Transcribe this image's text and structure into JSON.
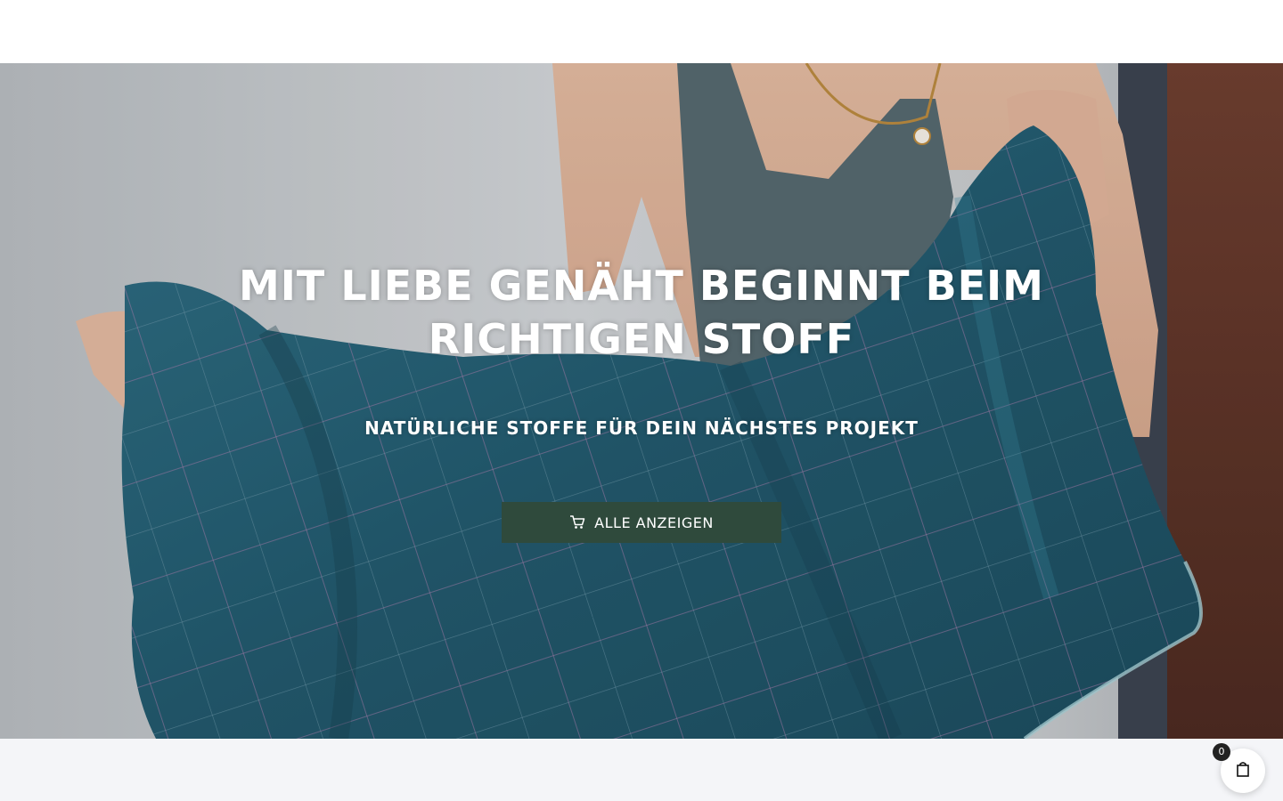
{
  "hero": {
    "title": "MIT LIEBE GENÄHT BEGINNT BEIM RICHTIGEN STOFF",
    "subtitle": "NATÜRLICHE STOFFE FÜR DEIN NÄCHSTES PROJEKT",
    "cta_label": "ALLE ANZEIGEN",
    "cta_icon": "cart-icon",
    "image_subject": "woman holding teal plaid linen fabric"
  },
  "cart": {
    "count": "0",
    "icon": "bag-icon"
  },
  "colors": {
    "cta_background": "#2f4a3c",
    "fabric": "#2a6378",
    "header_background": "#ffffff",
    "page_background": "#f4f5f8"
  }
}
